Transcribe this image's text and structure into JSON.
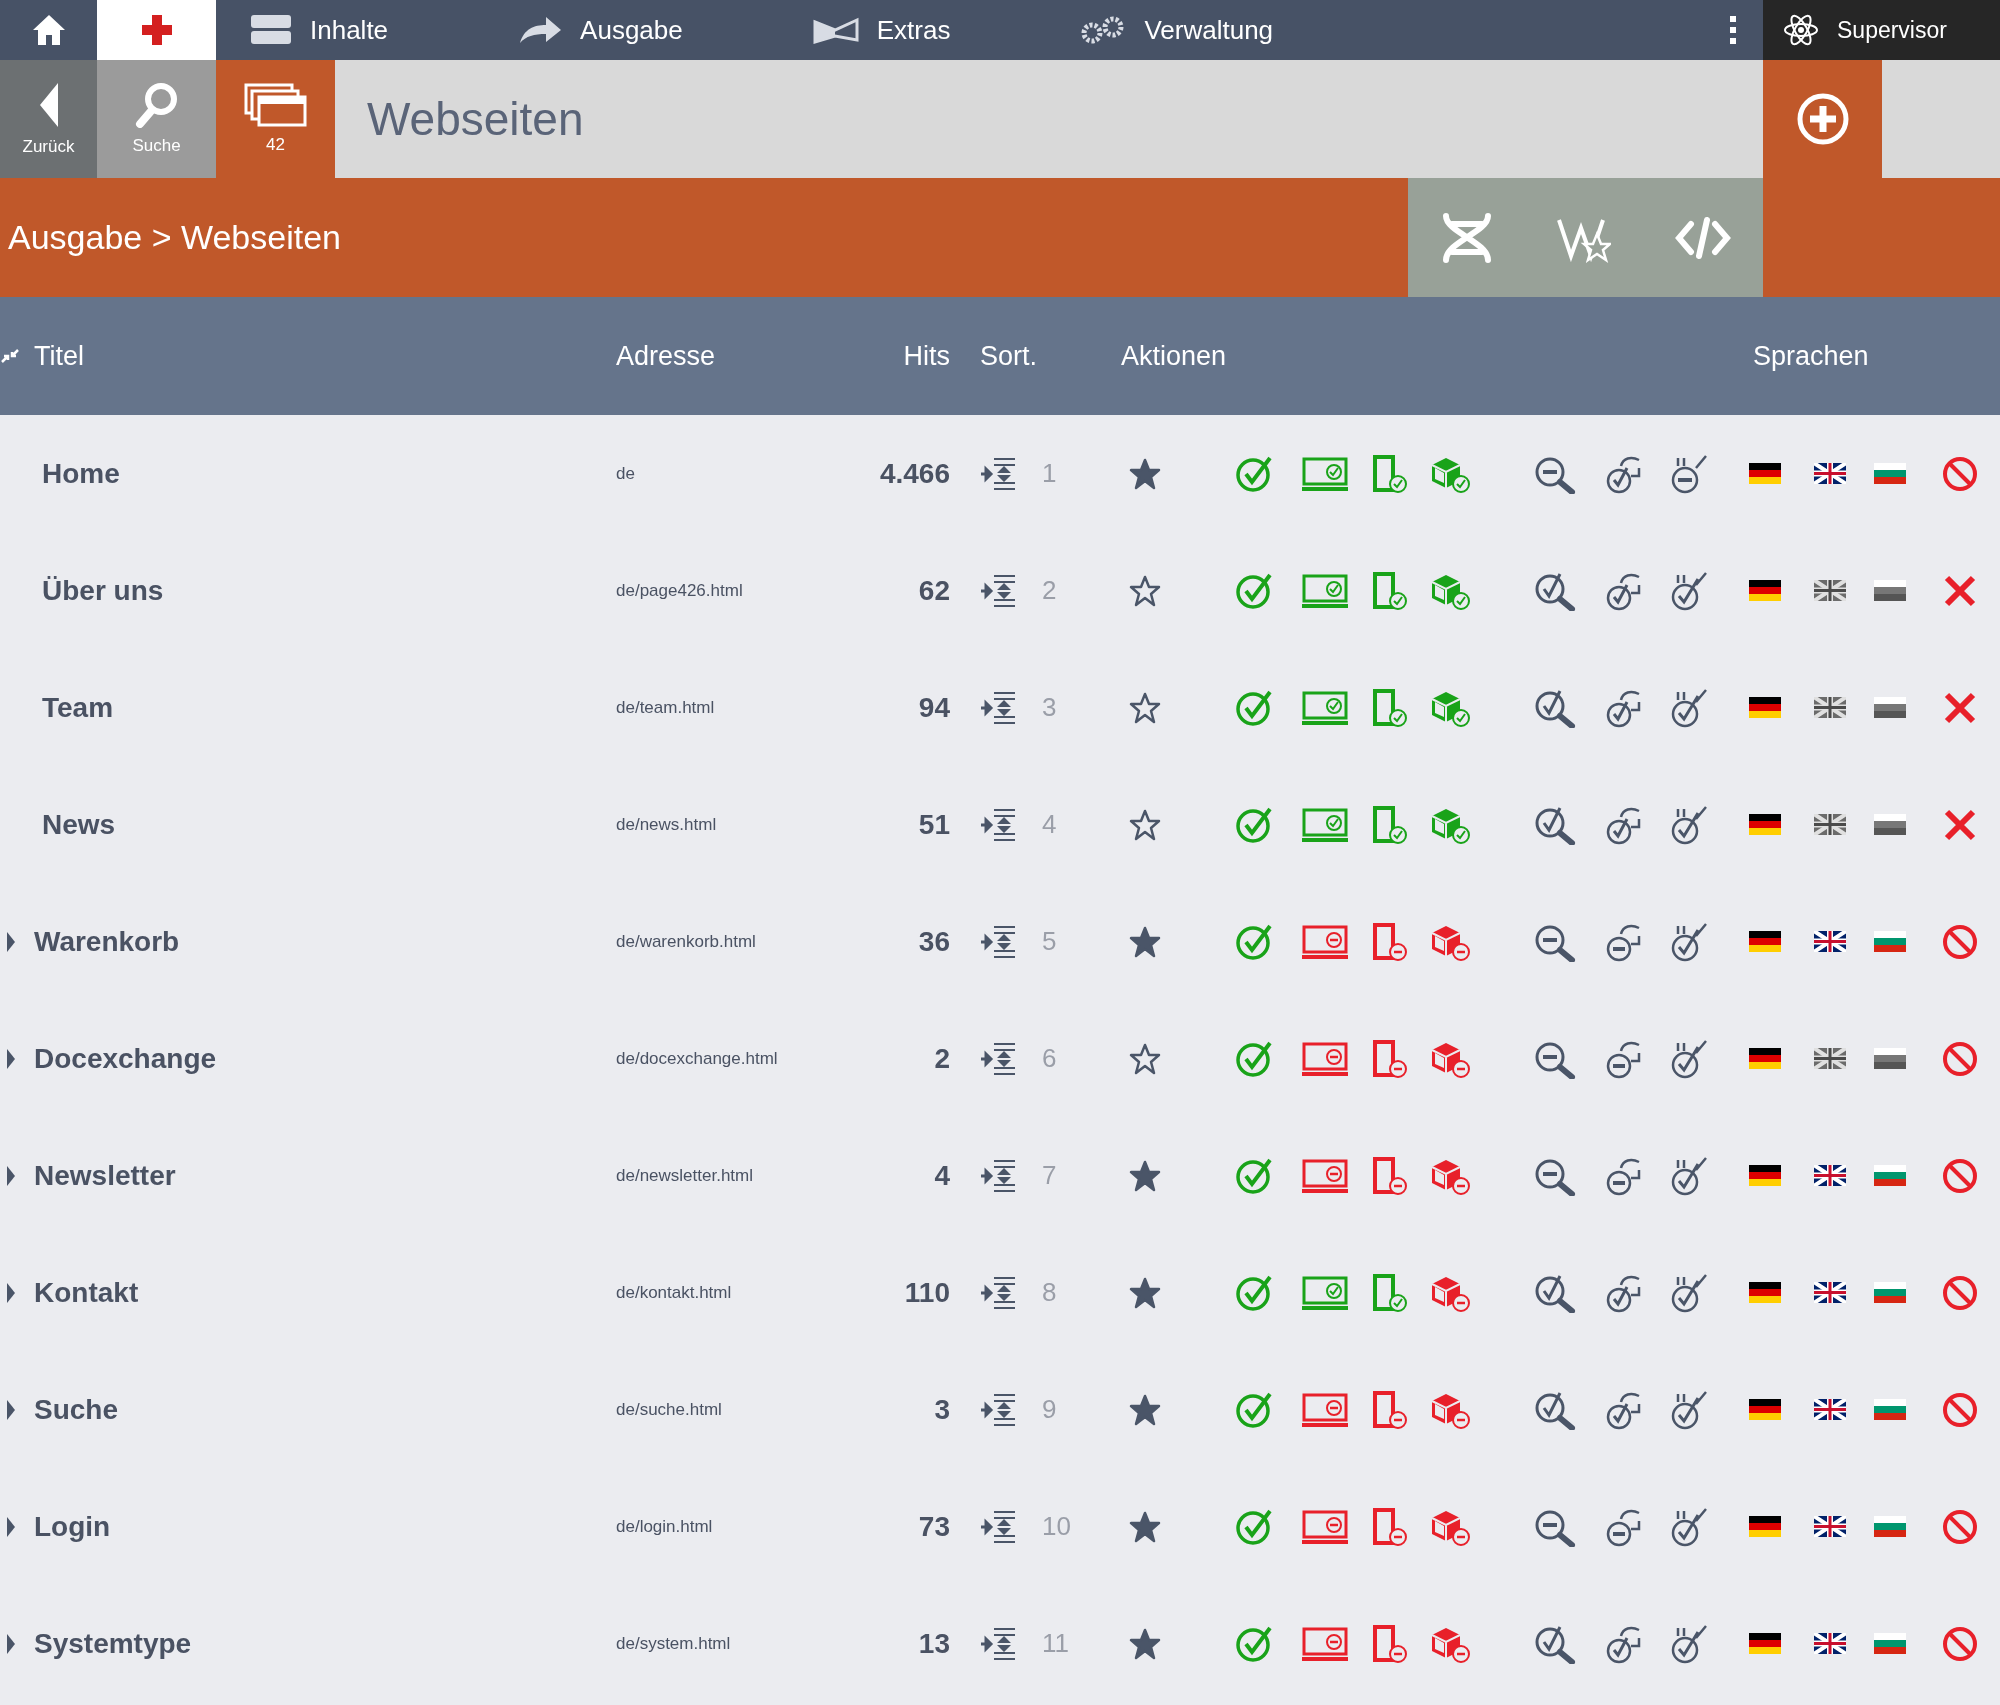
{
  "top_nav": {
    "items": [
      {
        "kind": "stack",
        "label": "Inhalte"
      },
      {
        "kind": "arrow",
        "label": "Ausgabe"
      },
      {
        "kind": "ribbon",
        "label": "Extras"
      },
      {
        "kind": "gears",
        "label": "Verwaltung"
      }
    ],
    "user": "Supervisor"
  },
  "toolbar": {
    "back": "Zurück",
    "search": "Suche",
    "count": "42",
    "title": "Webseiten"
  },
  "breadcrumb": "Ausgabe > Webseiten",
  "table": {
    "columns": [
      "Titel",
      "Adresse",
      "Hits",
      "Sort.",
      "Aktionen",
      "Sprachen"
    ],
    "rows": [
      {
        "title": "Home",
        "address": "de",
        "hits": "4.466",
        "sort": "1",
        "expandable": false,
        "favorite": true,
        "published": true,
        "desktop": true,
        "mobile": true,
        "app": true,
        "indexed": false,
        "linked": true,
        "approved": false,
        "languages": [
          {
            "kind": "de",
            "active": true
          },
          {
            "kind": "en",
            "active": true
          },
          {
            "kind": "bg",
            "active": true
          }
        ],
        "blocked": true
      },
      {
        "title": "Über uns",
        "address": "de/page426.html",
        "hits": "62",
        "sort": "2",
        "expandable": false,
        "favorite": false,
        "published": true,
        "desktop": true,
        "mobile": true,
        "app": true,
        "indexed": true,
        "linked": true,
        "approved": true,
        "languages": [
          {
            "kind": "de",
            "active": true
          },
          {
            "kind": "en",
            "active": false
          },
          {
            "kind": "bg",
            "active": false
          }
        ],
        "blocked": false
      },
      {
        "title": "Team",
        "address": "de/team.html",
        "hits": "94",
        "sort": "3",
        "expandable": false,
        "favorite": false,
        "published": true,
        "desktop": true,
        "mobile": true,
        "app": true,
        "indexed": true,
        "linked": true,
        "approved": true,
        "languages": [
          {
            "kind": "de",
            "active": true
          },
          {
            "kind": "en",
            "active": false
          },
          {
            "kind": "bg",
            "active": false
          }
        ],
        "blocked": false
      },
      {
        "title": "News",
        "address": "de/news.html",
        "hits": "51",
        "sort": "4",
        "expandable": false,
        "favorite": false,
        "published": true,
        "desktop": true,
        "mobile": true,
        "app": true,
        "indexed": true,
        "linked": true,
        "approved": true,
        "languages": [
          {
            "kind": "de",
            "active": true
          },
          {
            "kind": "en",
            "active": false
          },
          {
            "kind": "bg",
            "active": false
          }
        ],
        "blocked": false
      },
      {
        "title": "Warenkorb",
        "address": "de/warenkorb.html",
        "hits": "36",
        "sort": "5",
        "expandable": true,
        "favorite": true,
        "published": true,
        "desktop": false,
        "mobile": false,
        "app": false,
        "indexed": false,
        "linked": false,
        "approved": true,
        "languages": [
          {
            "kind": "de",
            "active": true
          },
          {
            "kind": "en",
            "active": true
          },
          {
            "kind": "bg",
            "active": true
          }
        ],
        "blocked": true
      },
      {
        "title": "Docexchange",
        "address": "de/docexchange.html",
        "hits": "2",
        "sort": "6",
        "expandable": true,
        "favorite": false,
        "published": true,
        "desktop": false,
        "mobile": false,
        "app": false,
        "indexed": false,
        "linked": false,
        "approved": true,
        "languages": [
          {
            "kind": "de",
            "active": true
          },
          {
            "kind": "en",
            "active": false
          },
          {
            "kind": "bg",
            "active": false
          }
        ],
        "blocked": true
      },
      {
        "title": "Newsletter",
        "address": "de/newsletter.html",
        "hits": "4",
        "sort": "7",
        "expandable": true,
        "favorite": true,
        "published": true,
        "desktop": false,
        "mobile": false,
        "app": false,
        "indexed": false,
        "linked": false,
        "approved": true,
        "languages": [
          {
            "kind": "de",
            "active": true
          },
          {
            "kind": "en",
            "active": true
          },
          {
            "kind": "bg",
            "active": true
          }
        ],
        "blocked": true
      },
      {
        "title": "Kontakt",
        "address": "de/kontakt.html",
        "hits": "110",
        "sort": "8",
        "expandable": true,
        "favorite": true,
        "published": true,
        "desktop": true,
        "mobile": true,
        "app": false,
        "indexed": true,
        "linked": true,
        "approved": true,
        "languages": [
          {
            "kind": "de",
            "active": true
          },
          {
            "kind": "en",
            "active": true
          },
          {
            "kind": "bg",
            "active": true
          }
        ],
        "blocked": true
      },
      {
        "title": "Suche",
        "address": "de/suche.html",
        "hits": "3",
        "sort": "9",
        "expandable": true,
        "favorite": true,
        "published": true,
        "desktop": false,
        "mobile": false,
        "app": false,
        "indexed": true,
        "linked": true,
        "approved": true,
        "languages": [
          {
            "kind": "de",
            "active": true
          },
          {
            "kind": "en",
            "active": true
          },
          {
            "kind": "bg",
            "active": true
          }
        ],
        "blocked": true
      },
      {
        "title": "Login",
        "address": "de/login.html",
        "hits": "73",
        "sort": "10",
        "expandable": true,
        "favorite": true,
        "published": true,
        "desktop": false,
        "mobile": false,
        "app": false,
        "indexed": false,
        "linked": false,
        "approved": true,
        "languages": [
          {
            "kind": "de",
            "active": true
          },
          {
            "kind": "en",
            "active": true
          },
          {
            "kind": "bg",
            "active": true
          }
        ],
        "blocked": true
      },
      {
        "title": "Systemtype",
        "address": "de/system.html",
        "hits": "13",
        "sort": "11",
        "expandable": true,
        "favorite": true,
        "published": true,
        "desktop": false,
        "mobile": false,
        "app": false,
        "indexed": true,
        "linked": true,
        "approved": true,
        "languages": [
          {
            "kind": "de",
            "active": true
          },
          {
            "kind": "en",
            "active": true
          },
          {
            "kind": "bg",
            "active": true
          }
        ],
        "blocked": true
      }
    ]
  }
}
